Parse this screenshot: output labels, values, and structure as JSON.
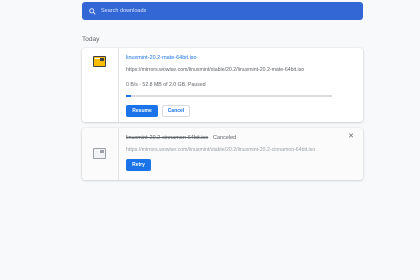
{
  "search": {
    "placeholder": "Search downloads",
    "icon": "search-icon"
  },
  "section": {
    "title": "Today"
  },
  "downloads": [
    {
      "file_name": "linuxmint-20.2-mate-64bit.iso",
      "url": "https://mirrors.wowise.com/linuxmint/stable/20.2/linuxmint-20.2-mate-64bit.iso",
      "progress_text": "0 B/s - 52.8 MB of 2.0 GB, Paused",
      "progress_percent": 2.6,
      "primary_button": "Resume",
      "secondary_button": "Cancel",
      "icon": "disc-image-file-icon"
    },
    {
      "file_name": "linuxmint-20.2-cinnamon-64bit.iso",
      "status": "Canceled",
      "url": "https://mirrors.wowise.com/linuxmint/stable/20.2/linuxmint-20.2-cinnamon-64bit.iso",
      "primary_button": "Retry",
      "icon": "disc-image-file-icon",
      "close_icon": "close-icon"
    }
  ],
  "colors": {
    "accent": "#1a73e8",
    "search_bar": "#3367d6"
  }
}
